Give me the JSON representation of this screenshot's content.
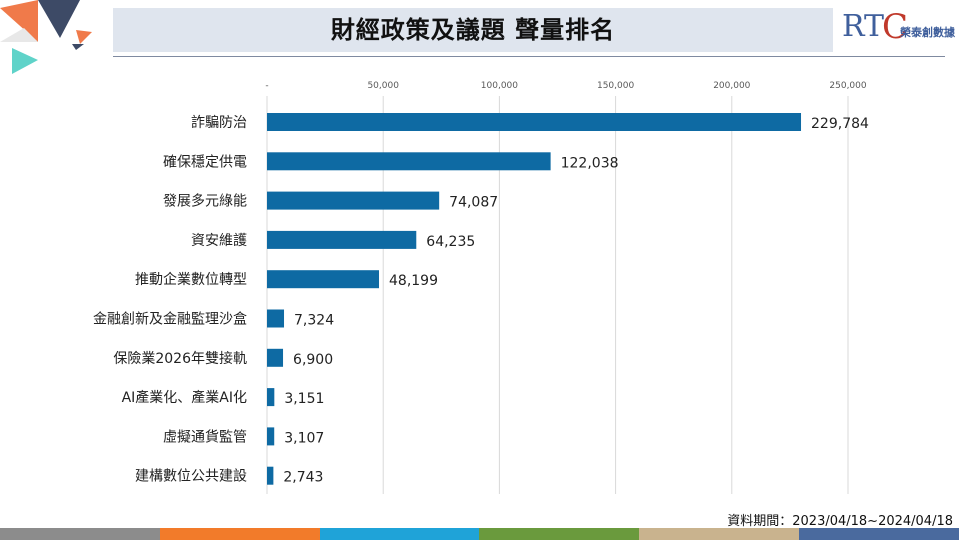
{
  "header": {
    "title": "財經政策及議題 聲量排名",
    "logo_text": "榮泰創數據",
    "logo_mark": "RTC"
  },
  "footer": {
    "note": "資料期間：2023/04/18~2024/04/18"
  },
  "colors": {
    "bar": "#0e6aa3",
    "title_bg": "#dfe5ee",
    "deco_orange": "#f07a4a",
    "deco_navy": "#3d4a66",
    "deco_teal": "#5fd3c9",
    "strip": [
      "#8c8c8c",
      "#f27b2a",
      "#1fa3d8",
      "#6a9a3d",
      "#c9b38e",
      "#4a6a9e"
    ]
  },
  "chart_data": {
    "type": "bar",
    "orientation": "horizontal",
    "categories": [
      "詐騙防治",
      "確保穩定供電",
      "發展多元綠能",
      "資安維護",
      "推動企業數位轉型",
      "金融創新及金融監理沙盒",
      "保險業2026年雙接軌",
      "AI產業化、產業AI化",
      "虛擬通貨監管",
      "建構數位公共建設"
    ],
    "values": [
      229784,
      122038,
      74087,
      64235,
      48199,
      7324,
      6900,
      3151,
      3107,
      2743
    ],
    "value_labels": [
      "229,784",
      "122,038",
      "74,087",
      "64,235",
      "48,199",
      "7,324",
      "6,900",
      "3,151",
      "3,107",
      "2,743"
    ],
    "xticks": [
      0,
      50000,
      100000,
      150000,
      200000,
      250000
    ],
    "xtick_labels": [
      "-",
      "50,000",
      "100,000",
      "150,000",
      "200,000",
      "250,000"
    ],
    "xlim": [
      0,
      250000
    ],
    "grid": true,
    "axis_position": "top"
  }
}
